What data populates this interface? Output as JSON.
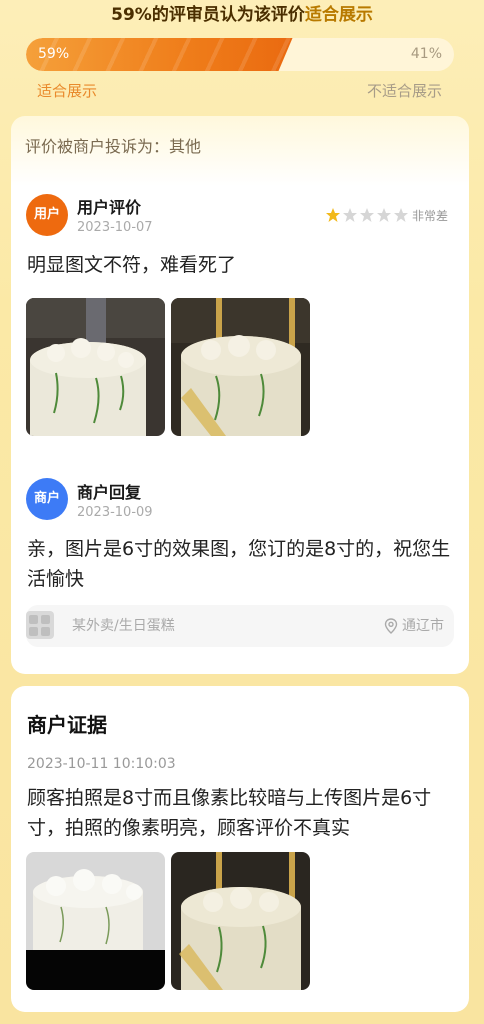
{
  "summary": {
    "pct_text": "59%",
    "middle_text": "的评审员认为该评价",
    "highlight_text": "适合展示"
  },
  "vote": {
    "suitable_fraction": 0.59,
    "suitable_pct_label": "59%",
    "unsuitable_pct_label": "41%",
    "suitable_label": "适合展示",
    "unsuitable_label": "不适合展示",
    "colors": {
      "suitable": "#ef7d1a",
      "unsuitable": "#fff5d8"
    }
  },
  "complaint": {
    "label": "评价被商户投诉为：其他"
  },
  "review": {
    "avatar_text": "用户",
    "title": "用户评价",
    "date": "2023-10-07",
    "rating": 1,
    "rating_max": 5,
    "rating_label": "非常差",
    "content": "明显图文不符，难看死了",
    "photos": [
      "cake-photo-1",
      "cake-photo-2"
    ]
  },
  "reply": {
    "avatar_text": "商户",
    "title": "商户回复",
    "date": "2023-10-09",
    "content": "亲，图片是6寸的效果图，您订的是8寸的，祝您生活愉快"
  },
  "store": {
    "name": "某外卖/生日蛋糕",
    "location": "通辽市"
  },
  "evidence": {
    "title": "商户证据",
    "time": "2023-10-11 10:10:03",
    "content": "顾客拍照是8寸而且像素比较暗与上传图片是6寸寸，拍照的像素明亮，顾客评价不真实",
    "photos": [
      "cake-photo-3",
      "cake-photo-4"
    ]
  },
  "colors": {
    "accent_orange": "#ee6a0f",
    "merchant_blue": "#3d7bf6",
    "star_gold": "#f2b91b"
  }
}
